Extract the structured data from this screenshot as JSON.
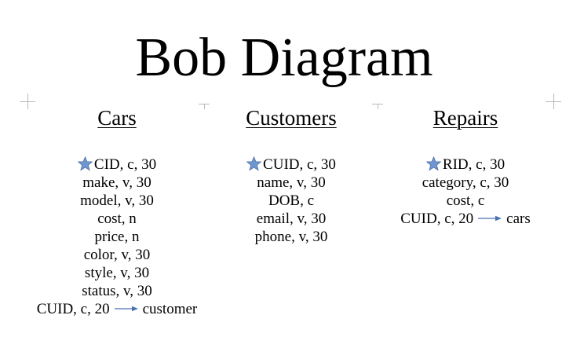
{
  "title": "Bob Diagram",
  "colors": {
    "star": "#6f96cf",
    "arrow": "#4a72b0",
    "corner_marks": "#b8b8b8"
  },
  "tables": [
    {
      "name": "Cars",
      "fields": [
        {
          "text": "CID, c, 30",
          "primary_key": true
        },
        {
          "text": "make, v, 30"
        },
        {
          "text": "model, v, 30"
        },
        {
          "text": "cost, n"
        },
        {
          "text": "price, n"
        },
        {
          "text": "color, v, 30"
        },
        {
          "text": "style, v, 30"
        },
        {
          "text": "status, v, 30"
        },
        {
          "text": "CUID, c, 20",
          "references": "customer"
        }
      ]
    },
    {
      "name": "Customers",
      "fields": [
        {
          "text": "CUID, c, 30",
          "primary_key": true
        },
        {
          "text": "name, v, 30"
        },
        {
          "text": "DOB, c"
        },
        {
          "text": "email, v, 30"
        },
        {
          "text": "phone, v, 30"
        }
      ]
    },
    {
      "name": "Repairs",
      "fields": [
        {
          "text": "RID, c, 30",
          "primary_key": true
        },
        {
          "text": "category, c, 30"
        },
        {
          "text": "cost, c"
        },
        {
          "text": "CUID, c, 20",
          "references": "cars"
        }
      ]
    }
  ]
}
